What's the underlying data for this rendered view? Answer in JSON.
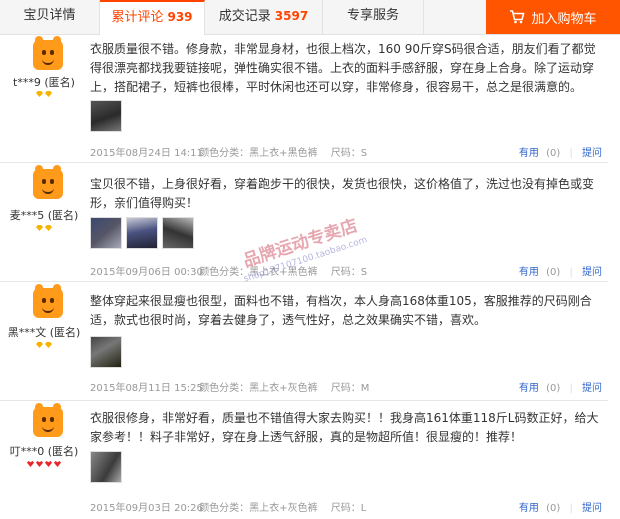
{
  "tabs": [
    {
      "label": "宝贝详情",
      "count": ""
    },
    {
      "label": "累计评论",
      "count": "939"
    },
    {
      "label": "成交记录",
      "count": "3597"
    },
    {
      "label": "专享服务",
      "count": ""
    }
  ],
  "cart_button": {
    "label": "加入购物车",
    "icon": "cart-icon"
  },
  "reviews": [
    {
      "user": "t***9 (匿名)",
      "badge": "yellow-diamond x2",
      "text": "衣服质量很不错。修身款，非常显身材，也很上档次，160 90斤穿S码很合适，朋友们看了都觉得很漂亮都找我要链接呢，弹性确实很不错。上衣的面料手感舒服，穿在身上合身。除了运动穿上，搭配裙子，短裤也很棒，平时休闲也还可以穿，非常修身，很容易干，总之是很满意的。",
      "date": "2015年08月24日 14:11",
      "attr": "颜色分类：黑上衣+黑色裤",
      "size": "尺码：S",
      "useful_label": "有用",
      "useful_count": "(0)",
      "ask_label": "提问"
    },
    {
      "user": "麦***5 (匿名)",
      "badge": "yellow-diamond x2",
      "text": "宝贝很不错，上身很好看，穿着跑步干的很快，发货也很快，这价格值了，洗过也没有掉色或变形，亲们值得购买！",
      "date": "2015年09月06日 00:30",
      "attr": "颜色分类：黑上衣+黑色裤",
      "size": "尺码：S",
      "useful_label": "有用",
      "useful_count": "(0)",
      "ask_label": "提问"
    },
    {
      "user": "黑***文 (匿名)",
      "badge": "yellow-diamond x2",
      "text": "整体穿起来很显瘦也很型，面料也不错，有档次，本人身高168体重105，客服推荐的尺码刚合适，款式也很时尚，穿着去健身了，透气性好，总之效果确实不错，喜欢。",
      "date": "2015年08月11日 15:25",
      "attr": "颜色分类：黑上衣+灰色裤",
      "size": "尺码：M",
      "useful_label": "有用",
      "useful_count": "(0)",
      "ask_label": "提问"
    },
    {
      "user": "叮***0 (匿名)",
      "badge": "red-heart x4",
      "text": "衣服很修身，非常好看，质量也不错值得大家去购买！！我身高161体重118斤L码数正好，给大家参考！！料子非常好，穿在身上透气舒服，真的是物超所值！很显瘦的！推荐！",
      "date": "2015年09月03日 20:26",
      "attr": "颜色分类：黑上衣+灰色裤",
      "size": "尺码：L",
      "useful_label": "有用",
      "useful_count": "(0)",
      "ask_label": "提问"
    }
  ],
  "watermark": {
    "text": "品牌运动专卖店",
    "sub": "shop137107100.taobao.com"
  },
  "colors": {
    "accent": "#ff5500",
    "link": "#3366cc",
    "muted": "#999999"
  }
}
